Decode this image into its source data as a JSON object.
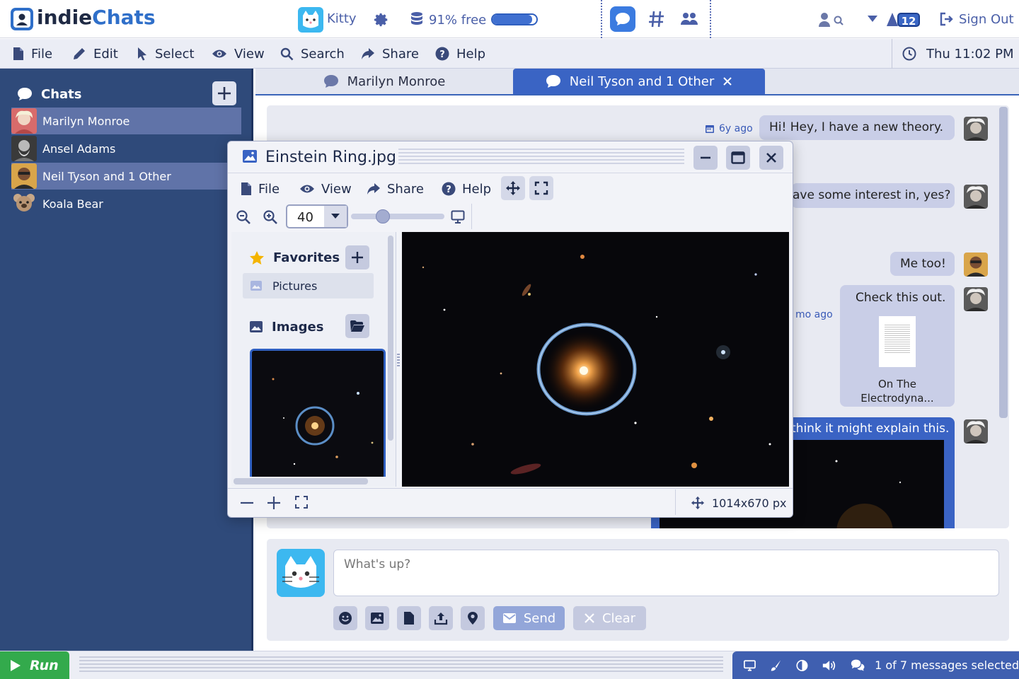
{
  "app": {
    "name_part1": "indie",
    "name_part2": "Chats"
  },
  "topbar": {
    "user": "Kitty",
    "memory": "91% free",
    "memory_fraction": 0.91,
    "badge_count": "12",
    "sign_out": "Sign Out"
  },
  "menu": {
    "file": "File",
    "edit": "Edit",
    "select": "Select",
    "view": "View",
    "search": "Search",
    "share": "Share",
    "help": "Help",
    "clock": "Thu 11:02 PM"
  },
  "sidebar": {
    "title": "Chats",
    "contacts": [
      {
        "name": "Marilyn Monroe"
      },
      {
        "name": "Ansel Adams"
      },
      {
        "name": "Neil Tyson and 1 Other"
      },
      {
        "name": "Koala Bear"
      }
    ]
  },
  "tabs": [
    {
      "label": "Marilyn Monroe"
    },
    {
      "label": "Neil Tyson and 1 Other"
    }
  ],
  "messages": {
    "m1_time": "6y ago",
    "m1_text": "Hi!   Hey, I have a new theory.",
    "m2_text": "ave some interest in, yes?",
    "m3_text": "Me too!",
    "m4_time": "mo ago",
    "m4_text": "Check this out.",
    "m4_file_line1": "On The",
    "m4_file_line2": "Electrodyna...",
    "m5_text": "think it might explain this."
  },
  "compose": {
    "placeholder": "What's up?",
    "send": "Send",
    "clear": "Clear"
  },
  "bottom": {
    "run": "Run",
    "status": "1 of 7 messages selected"
  },
  "viewer": {
    "title": "Einstein Ring.jpg",
    "menu_file": "File",
    "menu_view": "View",
    "menu_share": "Share",
    "menu_help": "Help",
    "zoom": "40",
    "zoom_fraction": 0.34,
    "favorites": "Favorites",
    "pictures": "Pictures",
    "images": "Images",
    "dimensions": "1014x670 px"
  },
  "colors": {
    "accent": "#3a64c4",
    "sidebar": "#2f4a7a",
    "run": "#33aa4c"
  }
}
